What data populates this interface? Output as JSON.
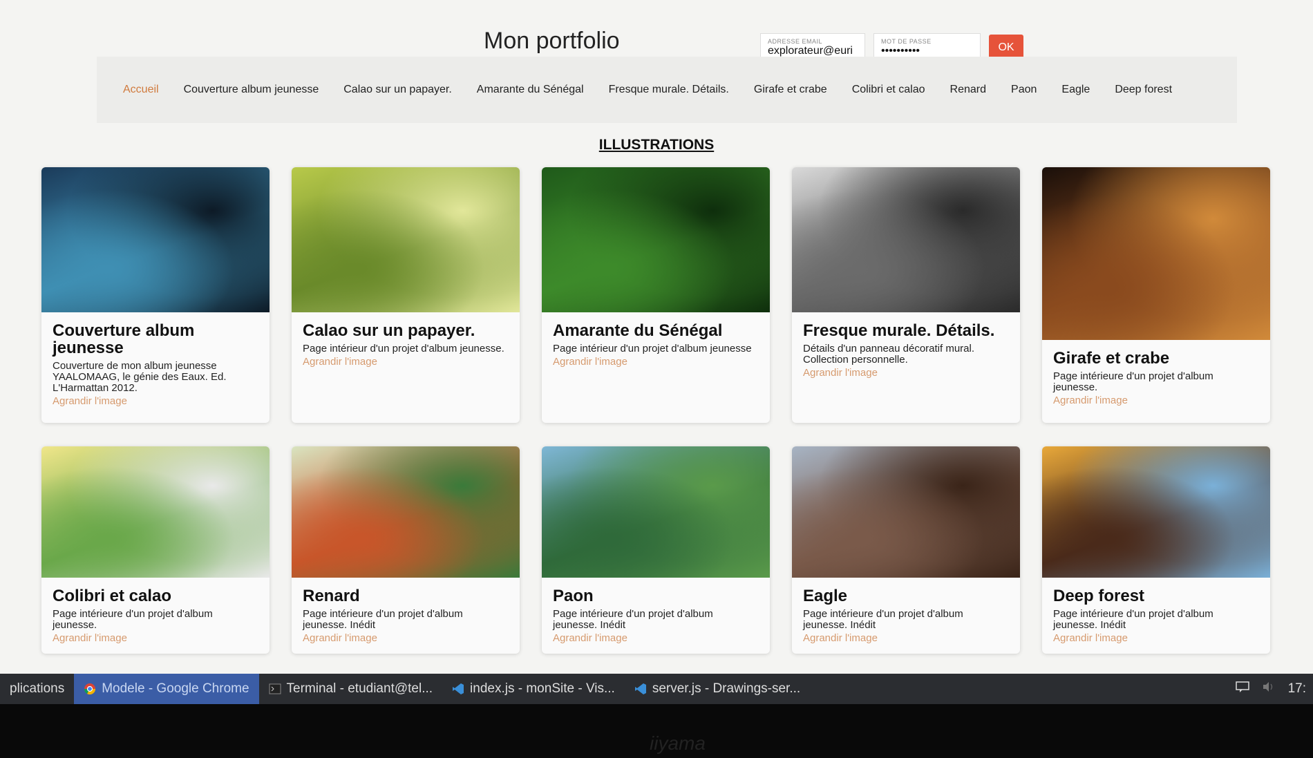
{
  "site": {
    "title": "Mon portfolio"
  },
  "login": {
    "email_label": "ADRESSE EMAIL",
    "email_value": "explorateur@euri",
    "password_label": "MOT DE PASSE",
    "password_value": "••••••••••",
    "ok_label": "OK"
  },
  "nav": {
    "items": [
      "Accueil",
      "Couverture album jeunesse",
      "Calao sur un papayer.",
      "Amarante du Sénégal",
      "Fresque murale. Détails.",
      "Girafe et crabe",
      "Colibri et calao",
      "Renard",
      "Paon",
      "Eagle",
      "Deep forest"
    ]
  },
  "section": {
    "heading": "ILLUSTRATIONS"
  },
  "cards": [
    {
      "title": "Couverture album jeunesse",
      "desc": "Couverture de mon album jeunesse YAALOMAAG, le génie des Eaux. Ed. L'Harmattan 2012.",
      "link": "Agrandir l'image",
      "palette": [
        "#1b3b5a",
        "#3f8fb3",
        "#0d1a26"
      ]
    },
    {
      "title": "Calao sur un papayer.",
      "desc": "Page intérieur d'un projet d'album jeunesse.",
      "link": "Agrandir l'image",
      "palette": [
        "#b8c94a",
        "#6a8a2a",
        "#e2e79a"
      ]
    },
    {
      "title": "Amarante du Sénégal",
      "desc": "Page intérieur d'un projet d'album jeunesse",
      "link": "Agrandir l'image",
      "palette": [
        "#1f5a1a",
        "#3d8a2a",
        "#0e2e0c"
      ]
    },
    {
      "title": "Fresque murale. Détails.",
      "desc": "Détails d'un panneau décoratif mural. Collection personnelle.",
      "link": "Agrandir l'image",
      "palette": [
        "#d9d9d9",
        "#6b6b6b",
        "#2a2a2a"
      ]
    },
    {
      "title": "Girafe et crabe",
      "desc": "Page intérieure d'un projet d'album jeunesse.",
      "link": "Agrandir l'image",
      "palette": [
        "#1a0f0a",
        "#8a4a1e",
        "#d18a3a"
      ]
    },
    {
      "title": "Colibri et calao",
      "desc": "Page intérieure d'un projet d'album jeunesse.",
      "link": "Agrandir l'image",
      "palette": [
        "#f0e68a",
        "#6aa84a",
        "#e9e9e9"
      ]
    },
    {
      "title": "Renard",
      "desc": "Page intérieure d'un projet d'album jeunesse. Inédit",
      "link": "Agrandir l'image",
      "palette": [
        "#d9e4c0",
        "#c8562a",
        "#3a7a3a"
      ]
    },
    {
      "title": "Paon",
      "desc": "Page intérieure d'un projet d'album jeunesse. Inédit",
      "link": "Agrandir l'image",
      "palette": [
        "#7fb7d6",
        "#2f6a3a",
        "#5a9a4a"
      ]
    },
    {
      "title": "Eagle",
      "desc": "Page intérieure d'un projet d'album jeunesse. Inédit",
      "link": "Agrandir l'image",
      "palette": [
        "#a7b4c4",
        "#7a5a4a",
        "#3a2418"
      ]
    },
    {
      "title": "Deep forest",
      "desc": "Page intérieure d'un projet d'album jeunesse. Inédit",
      "link": "Agrandir l'image",
      "palette": [
        "#e8a83a",
        "#4a2a1a",
        "#7ab0d8"
      ]
    }
  ],
  "taskbar": {
    "apps_label": "plications",
    "tasks": [
      {
        "label": "Modele - Google Chrome",
        "icon": "chrome-icon",
        "active": true
      },
      {
        "label": "Terminal - etudiant@tel...",
        "icon": "terminal-icon",
        "active": false
      },
      {
        "label": "index.js - monSite - Vis...",
        "icon": "vscode-icon",
        "active": false
      },
      {
        "label": "server.js - Drawings-ser...",
        "icon": "vscode-icon",
        "active": false
      }
    ],
    "clock": "17:"
  },
  "monitor": {
    "brand": "iiyama"
  },
  "colors": {
    "accent": "#e6533a",
    "link": "#d69a6e",
    "taskbar_active": "#3b5da6"
  }
}
